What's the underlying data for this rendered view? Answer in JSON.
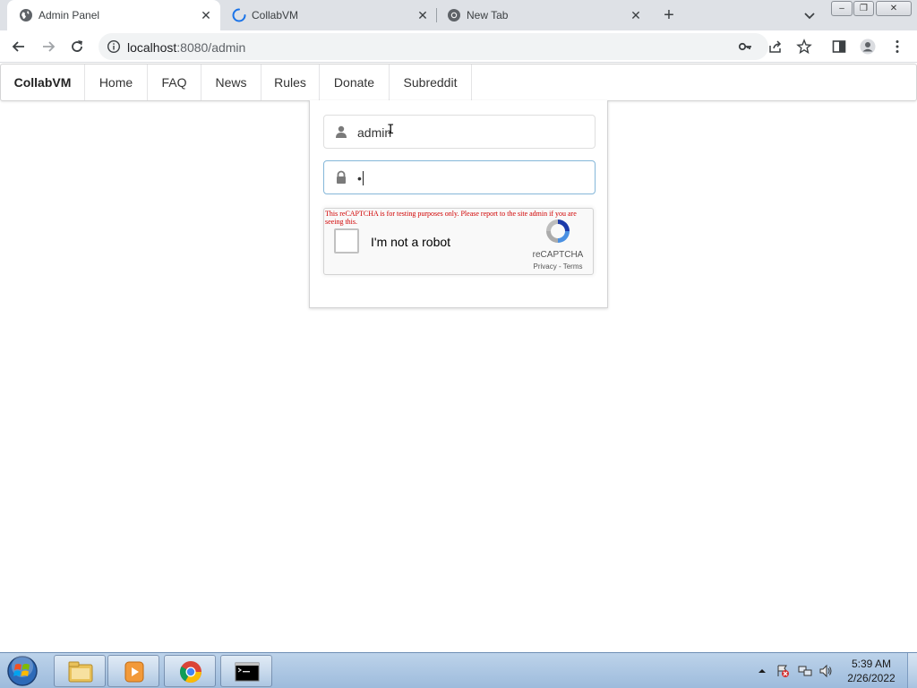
{
  "browser": {
    "tabs": [
      {
        "title": "Admin Panel",
        "icon": "globe-icon",
        "active": true
      },
      {
        "title": "CollabVM",
        "icon": "loading-spinner-icon",
        "active": false
      },
      {
        "title": "New Tab",
        "icon": "chrome-icon",
        "active": false
      }
    ],
    "tab_close_glyph": "✕",
    "new_tab_glyph": "+",
    "window_controls": {
      "minimize": "–",
      "restore": "❐",
      "close": "✕"
    },
    "address": {
      "host": "localhost",
      "path": ":8080/admin"
    },
    "toolbar_icons": [
      "back-icon",
      "forward-icon",
      "reload-icon",
      "site-info-icon",
      "key-icon",
      "share-icon",
      "star-icon",
      "side-panel-icon",
      "profile-icon",
      "menu-icon"
    ]
  },
  "site_nav": {
    "brand": "CollabVM",
    "items": [
      "Home",
      "FAQ",
      "News",
      "Rules",
      "Donate",
      "Subreddit"
    ]
  },
  "login": {
    "username_value": "admin",
    "password_value": "•",
    "username_icon": "user-icon",
    "password_icon": "lock-icon"
  },
  "recaptcha": {
    "warning": "This reCAPTCHA is for testing purposes only. Please report to the site admin if you are seeing this.",
    "label": "I'm not a robot",
    "brand": "reCAPTCHA",
    "links": "Privacy - Terms",
    "checked": false
  },
  "taskbar": {
    "buttons": [
      "start-orb",
      "explorer-icon",
      "media-player-icon",
      "chrome-icon",
      "cmd-icon"
    ],
    "clock_time": "5:39 AM",
    "clock_date": "2/26/2022"
  },
  "colors": {
    "tabstrip": "#dee1e6",
    "recaptcha_warning": "#d00000",
    "focus_border": "#85b7d9",
    "taskbar": "#a9c4e2"
  }
}
